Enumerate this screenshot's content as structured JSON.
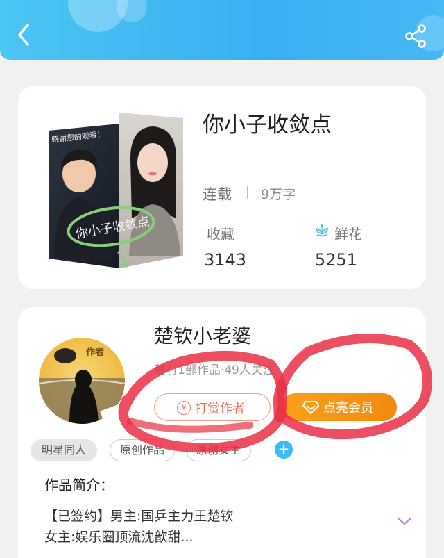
{
  "header": {
    "back_icon": "chevron-left-icon",
    "share_icon": "share-icon"
  },
  "book": {
    "title": "你小子收敛点",
    "status": "连载",
    "words": "9万字",
    "favorites_label": "收藏",
    "favorites_count": "3143",
    "flowers_label": "鲜花",
    "flowers_count": "5251",
    "cover": {
      "text_top": "感谢您的观看！",
      "text_circle": "你小子收敛点"
    }
  },
  "author": {
    "name": "楚钦小老婆",
    "meta": "著有1部作品·49人关注",
    "badge": "作者",
    "tip_label": "打赏作者",
    "vip_label": "点亮会员"
  },
  "tags": [
    "明星同人",
    "原创作品",
    "原创女主"
  ],
  "intro": {
    "title": "作品简介：",
    "line1": "【已签约】男主:国乒主力王楚钦",
    "line2": "女主:娱乐圈顶流沈歆甜..."
  },
  "colors": {
    "header": "#3aaef2",
    "vip": "#f5950f",
    "tip": "#e5735c",
    "annotation": "#ea2f45"
  }
}
